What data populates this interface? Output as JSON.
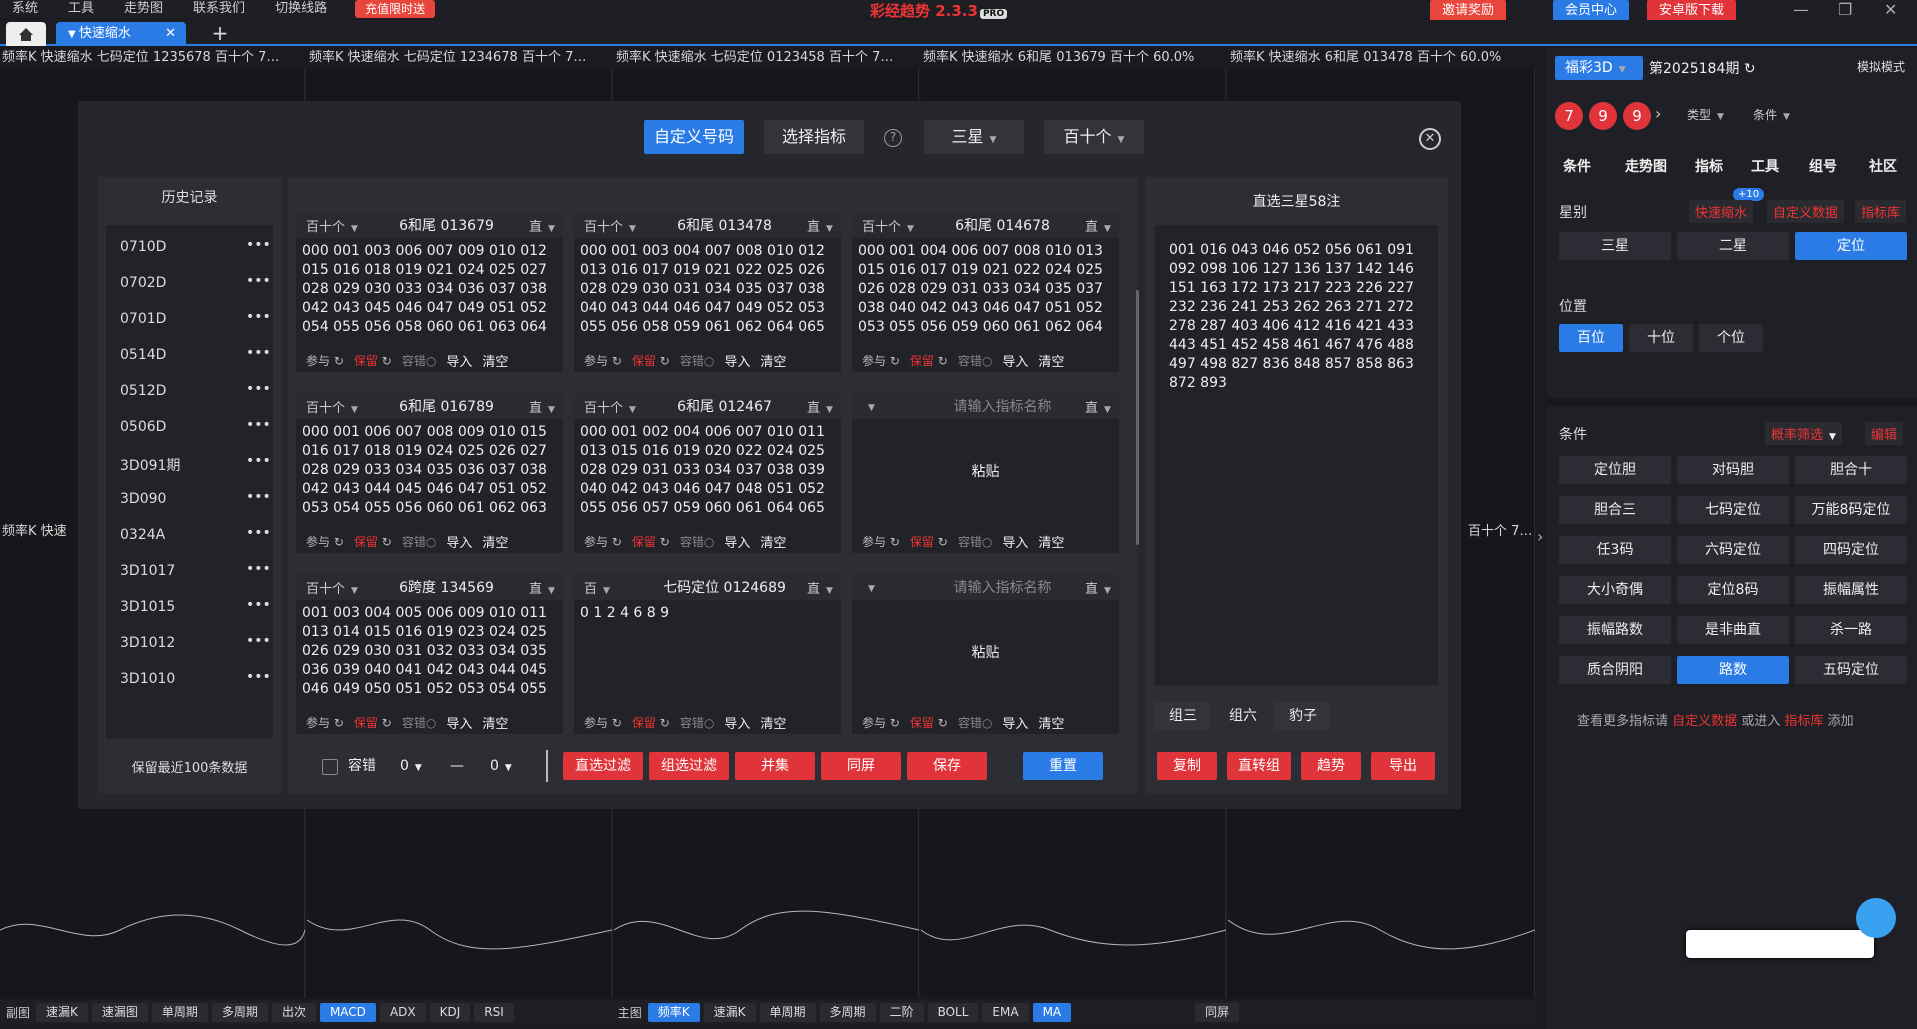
{
  "menubar": {
    "items": [
      "系统",
      "工具",
      "走势图",
      "联系我们",
      "切换线路"
    ],
    "promo": "充值限时送",
    "app_name": "彩经趋势 2.3.3",
    "app_badge": "PRO",
    "invite": "邀请奖励",
    "member": "会员中心",
    "android": "安卓版下载"
  },
  "tabs": {
    "doc_tab": "快速缩水",
    "close": "✕",
    "add": "+"
  },
  "chart_headers": [
    "频率K  快速缩水  七码定位 1235678  百十个  7…",
    "频率K  快速缩水  七码定位 1234678  百十个  7…",
    "频率K  快速缩水  七码定位 0123458  百十个  7…",
    "频率K  快速缩水  6和尾 013679  百十个  60.0%",
    "频率K  快速缩水  6和尾 013478  百十个  60.0%"
  ],
  "chart_side_labels": {
    "left": "频率K  快速",
    "right": "百十个  7…"
  },
  "bottombar": {
    "left_label": "副图",
    "left_items": [
      "速漏K",
      "速漏图",
      "单周期",
      "多周期",
      "出次",
      "MACD",
      "ADX",
      "KDJ",
      "RSI"
    ],
    "left_active": "MACD",
    "right_label": "主图",
    "right_items": [
      "频率K",
      "速漏K",
      "单周期",
      "多周期",
      "二阶",
      "BOLL",
      "EMA",
      "MA"
    ],
    "right_active_1": "频率K",
    "right_active_2": "MA",
    "split": "同屏"
  },
  "right_panel": {
    "lottery": "福彩3D",
    "period": "第2025184期",
    "sim_mode": "模拟模式",
    "balls": [
      "7",
      "9",
      "9"
    ],
    "type_label": "类型",
    "cond_label": "条件",
    "tabs": [
      "条件",
      "走势图",
      "指标",
      "工具",
      "组号",
      "社区"
    ],
    "star_label": "星别",
    "star_links": [
      "快速缩水",
      "自定义数据",
      "指标库"
    ],
    "star_badge": "+10",
    "star_buttons": [
      "三星",
      "二星",
      "定位"
    ],
    "star_active": "定位",
    "pos_label": "位置",
    "pos_buttons": [
      "百位",
      "十位",
      "个位"
    ],
    "pos_active": "百位",
    "cond_section": "条件",
    "prob_filter": "概率筛选",
    "edit": "编辑",
    "cond_buttons": [
      "定位胆",
      "对码胆",
      "胆合十",
      "胆合三",
      "七码定位",
      "万能8码定位",
      "任3码",
      "六码定位",
      "四码定位",
      "大小奇偶",
      "定位8码",
      "振幅属性",
      "振幅路数",
      "是非曲直",
      "杀一路",
      "质合阴阳",
      "路数",
      "五码定位"
    ],
    "cond_active": "路数",
    "more_prefix": "查看更多指标请",
    "more_link1": "自定义数据",
    "more_mid": "或进入",
    "more_link2": "指标库",
    "more_suffix": "添加"
  },
  "modal": {
    "tab_custom": "自定义号码",
    "tab_select": "选择指标",
    "help": "?",
    "star": "三星",
    "pos": "百十个",
    "close": "✕",
    "history_title": "历史记录",
    "history_items": [
      "0710D",
      "0702D",
      "0701D",
      "0514D",
      "0512D",
      "0506D",
      "3D091期",
      "3D090",
      "0324A",
      "3D1017",
      "3D1015",
      "3D1012",
      "3D1010"
    ],
    "history_dots": "•••",
    "history_footer": "保留最近100条数据",
    "cards": [
      {
        "sel": "百十个",
        "name": "6和尾 013679",
        "mode": "直",
        "body": "000 001 003 006 007 009 010 012 015 016 018 019 021 024 025 027 028 029 030 033 034 036 037 038 042 043 045 046 047 049 051 052 054 055 056 058 060 061 063 064"
      },
      {
        "sel": "百十个",
        "name": "6和尾 013478",
        "mode": "直",
        "body": "000 001 003 004 007 008 010 012 013 016 017 019 021 022 025 026 028 029 030 031 034 035 037 038 040 043 044 046 047 049 052 053 055 056 058 059 061 062 064 065"
      },
      {
        "sel": "百十个",
        "name": "6和尾 014678",
        "mode": "直",
        "body": "000 001 004 006 007 008 010 013 015 016 017 019 021 022 024 025 026 028 029 031 033 034 035 037 038 040 042 043 046 047 051 052 053 055 056 059 060 061 062 064"
      },
      {
        "sel": "百十个",
        "name": "6和尾 016789",
        "mode": "直",
        "body": "000 001 006 007 008 009 010 015 016 017 018 019 024 025 026 027 028 029 033 034 035 036 037 038 042 043 044 045 046 047 051 052 053 054 055 056 060 061 062 063"
      },
      {
        "sel": "百十个",
        "name": "6和尾 012467",
        "mode": "直",
        "body": "000 001 002 004 006 007 010 011 013 015 016 019 020 022 024 025 028 029 031 033 034 037 038 039 040 042 043 046 047 048 051 052 055 056 057 059 060 061 064 065"
      },
      {
        "sel": "",
        "name": "请输入指标名称",
        "mode": "直",
        "body": "粘贴",
        "placeholder": true
      },
      {
        "sel": "百十个",
        "name": "6跨度 134569",
        "mode": "直",
        "body": "001 003 004 005 006 009 010 011 013 014 015 016 019 023 024 025 026 029 030 031 032 033 034 035 036 039 040 041 042 043 044 045 046 049 050 051 052 053 054 055"
      },
      {
        "sel": "百",
        "name": "七码定位 0124689",
        "mode": "直",
        "body": "0 1 2 4 6 8 9"
      },
      {
        "sel": "",
        "name": "请输入指标名称",
        "mode": "直",
        "body": "粘贴",
        "placeholder": true
      }
    ],
    "card_foot": {
      "ref": "参与",
      "keep": "保留",
      "tol": "容错",
      "imp": "导入",
      "clr": "清空"
    },
    "tolerance": "容错",
    "tol_min": "0",
    "tol_dash": "—",
    "tol_max": "0",
    "actions": [
      "直选过滤",
      "组选过滤",
      "并集",
      "同屏",
      "保存"
    ],
    "reset": "重置",
    "result_title": "直选三星58注",
    "result_text": "001 016 043 046 052 056 061 091 092 098 106 127 136 137 142 146 151 163 172 173 217 223 226 227 232 236 241 253 262 263 271 272 278 287 403 406 412 416 421 433 443 451 452 458 461 467 476 488 497 498 827 836 848 857 858 863 872 893",
    "result_tabs": [
      "组三",
      "组六",
      "豹子"
    ],
    "result_actions": [
      "复制",
      "直转组",
      "趋势",
      "导出"
    ]
  },
  "colors": {
    "accent": "#2b7be6",
    "red": "#e0343a",
    "bg": "#1a1b20",
    "panel": "#2d2e34"
  }
}
